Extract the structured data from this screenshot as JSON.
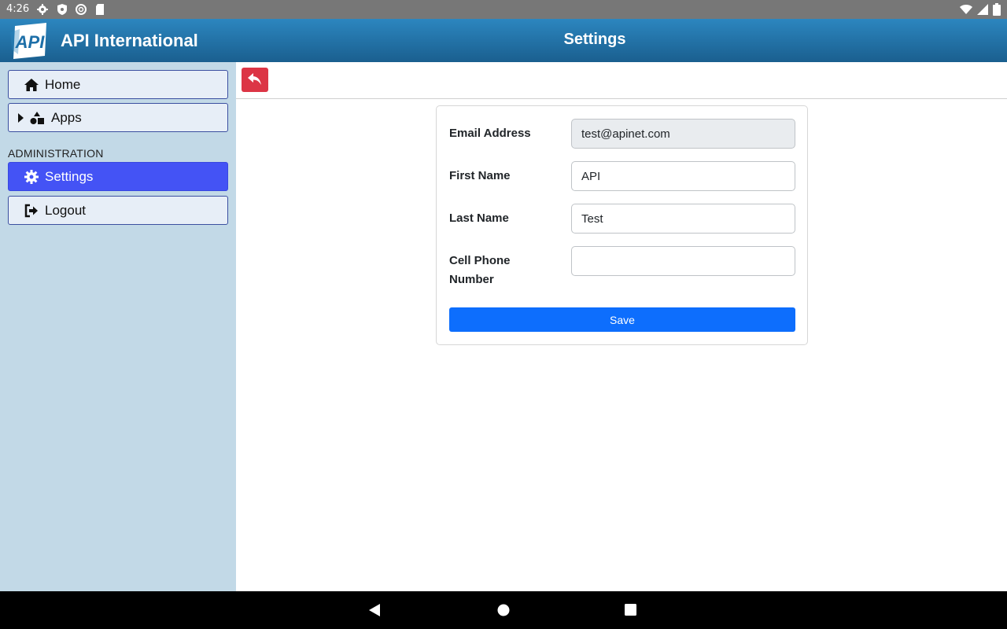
{
  "status_bar": {
    "time": "4:26"
  },
  "header": {
    "app_name": "API International",
    "page_title": "Settings",
    "logo_text": "API"
  },
  "sidebar": {
    "items": [
      {
        "label": "Home",
        "icon": "home-icon"
      },
      {
        "label": "Apps",
        "icon": "shapes-icon"
      }
    ],
    "section_label": "ADMINISTRATION",
    "admin_items": [
      {
        "label": "Settings",
        "icon": "gear-icon",
        "active": true
      },
      {
        "label": "Logout",
        "icon": "logout-icon"
      }
    ]
  },
  "form": {
    "email": {
      "label": "Email Address",
      "value": "test@apinet.com"
    },
    "first_name": {
      "label": "First Name",
      "value": "API"
    },
    "last_name": {
      "label": "Last Name",
      "value": "Test"
    },
    "cell_phone": {
      "label_line1": "Cell Phone",
      "label_line2": "Number",
      "value": ""
    },
    "save_label": "Save"
  },
  "colors": {
    "header_top": "#2c86bf",
    "header_bottom": "#1a5f8f",
    "sidebar_bg": "#c2d9e7",
    "active_nav": "#4453f5",
    "back_button": "#dc3545",
    "save_button": "#0d6efd"
  }
}
